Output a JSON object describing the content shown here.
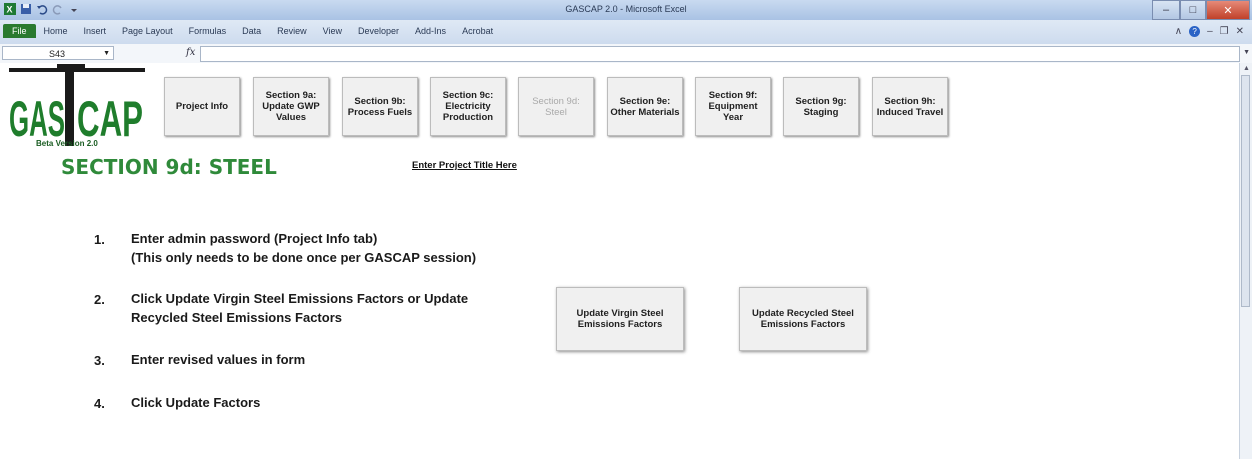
{
  "window": {
    "title": "GASCAP 2.0 - Microsoft Excel"
  },
  "ribbon": {
    "file_tab": "File",
    "tabs": [
      "Home",
      "Insert",
      "Page Layout",
      "Formulas",
      "Data",
      "Review",
      "View",
      "Developer",
      "Add-Ins",
      "Acrobat"
    ]
  },
  "formula_bar": {
    "cell_ref": "S43",
    "fx_label": "fx",
    "content": ""
  },
  "logo": {
    "text_left": "GAS",
    "text_right": "CAP",
    "version": "Beta Version 2.0",
    "brand_color": "#1f7d2c"
  },
  "nav_buttons": [
    {
      "label": "Project Info",
      "enabled": true
    },
    {
      "label": "Section 9a: Update GWP Values",
      "enabled": true
    },
    {
      "label": "Section 9b: Process Fuels",
      "enabled": true
    },
    {
      "label": "Section 9c: Electricity Production",
      "enabled": true
    },
    {
      "label": "Section 9d: Steel",
      "enabled": false
    },
    {
      "label": "Section 9e: Other Materials",
      "enabled": true
    },
    {
      "label": "Section 9f: Equipment Year",
      "enabled": true
    },
    {
      "label": "Section 9g: Staging",
      "enabled": true
    },
    {
      "label": "Section 9h: Induced Travel",
      "enabled": true
    }
  ],
  "page": {
    "section_title": "SECTION 9d: STEEL",
    "project_title_link": "Enter Project Title Here",
    "title_color": "#2f8a3a"
  },
  "steps": [
    {
      "num": "1.",
      "lines": [
        "Enter admin password (Project Info tab)",
        "(This only needs to be done once per GASCAP session)"
      ]
    },
    {
      "num": "2.",
      "lines": [
        "Click Update Virgin Steel Emissions Factors or Update",
        "Recycled Steel Emissions Factors"
      ]
    },
    {
      "num": "3.",
      "lines": [
        "Enter revised values in form"
      ]
    },
    {
      "num": "4.",
      "lines": [
        "Click Update Factors"
      ]
    }
  ],
  "actions": {
    "virgin": "Update Virgin Steel Emissions Factors",
    "recycled": "Update Recycled Steel Emissions Factors"
  }
}
